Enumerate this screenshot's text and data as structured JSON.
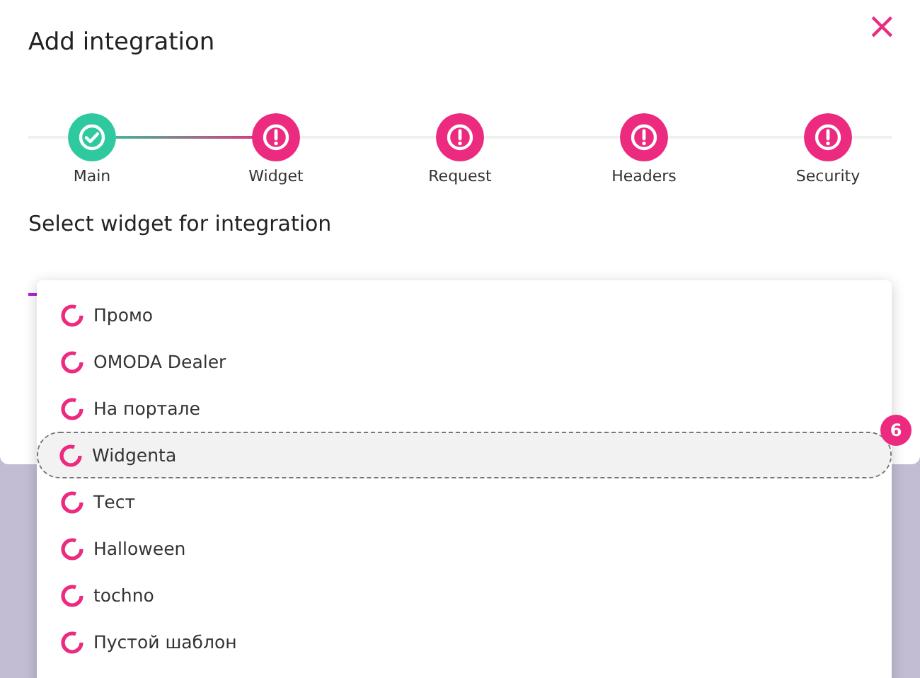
{
  "dialog": {
    "title": "Add integration",
    "close": "×"
  },
  "steps": [
    {
      "label": "Main",
      "kind": "done"
    },
    {
      "label": "Widget",
      "kind": "warning"
    },
    {
      "label": "Request",
      "kind": "warning"
    },
    {
      "label": "Headers",
      "kind": "warning"
    },
    {
      "label": "Security",
      "kind": "warning"
    }
  ],
  "section_title": "Select widget for integration",
  "dropdown": {
    "items": [
      {
        "label": "Промо",
        "selected": false
      },
      {
        "label": "OMODA Dealer",
        "selected": false
      },
      {
        "label": "На портале",
        "selected": false
      },
      {
        "label": "Widgenta",
        "selected": true,
        "callout": "6"
      },
      {
        "label": "Тест",
        "selected": false
      },
      {
        "label": "Halloween",
        "selected": false
      },
      {
        "label": "tochno",
        "selected": false
      },
      {
        "label": "Пустой шаблон",
        "selected": false
      }
    ]
  }
}
